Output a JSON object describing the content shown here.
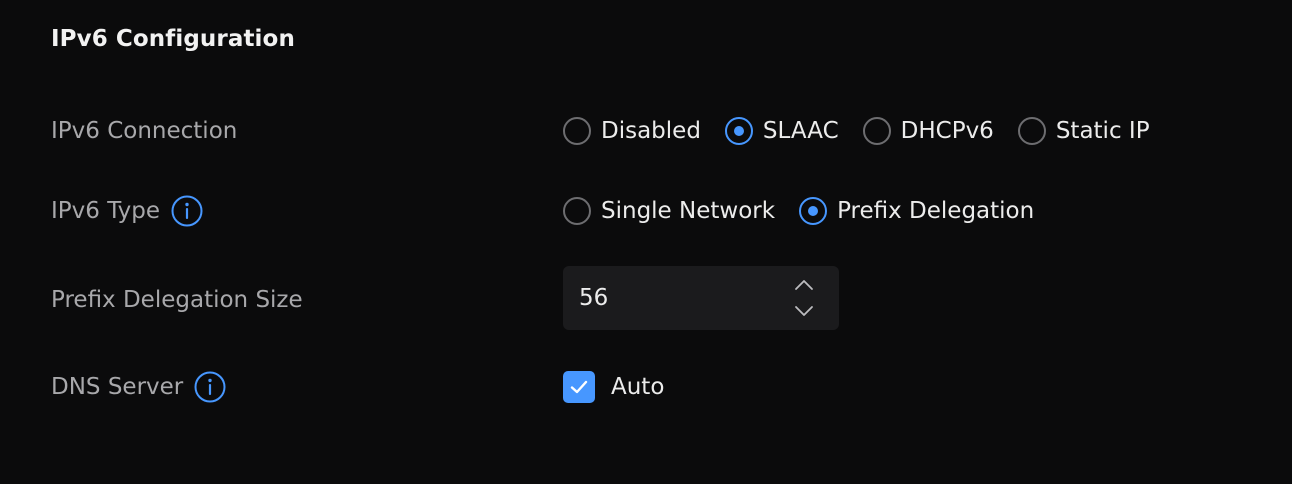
{
  "section": {
    "title": "IPv6 Configuration"
  },
  "rows": {
    "connection": {
      "label": "IPv6 Connection",
      "options": [
        "Disabled",
        "SLAAC",
        "DHCPv6",
        "Static IP"
      ],
      "selected": "SLAAC"
    },
    "type": {
      "label": "IPv6 Type",
      "info_icon": "info-icon",
      "options": [
        "Single Network",
        "Prefix Delegation"
      ],
      "selected": "Prefix Delegation"
    },
    "prefix_size": {
      "label": "Prefix Delegation Size",
      "value": "56",
      "up_icon": "chevron-up-icon",
      "down_icon": "chevron-down-icon"
    },
    "dns": {
      "label": "DNS Server",
      "info_icon": "info-icon",
      "checkbox_label": "Auto",
      "checked": true
    }
  },
  "colors": {
    "background": "#0b0b0c",
    "accent": "#4797ff",
    "label": "#a8a8ab",
    "text": "#ececec",
    "input_bg": "#1b1b1d"
  }
}
